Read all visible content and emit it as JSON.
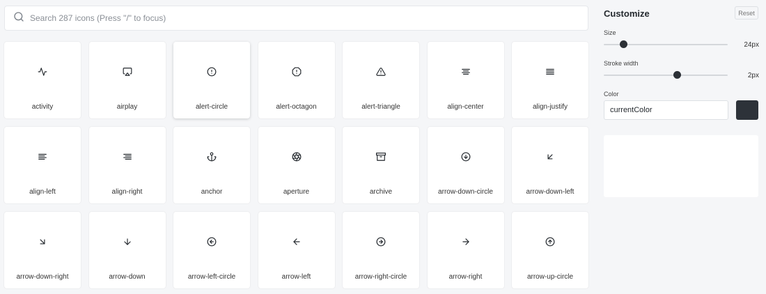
{
  "search": {
    "placeholder": "Search 287 icons (Press \"/\" to focus)"
  },
  "icons": [
    {
      "name": "activity",
      "icon": "activity-icon"
    },
    {
      "name": "airplay",
      "icon": "airplay-icon"
    },
    {
      "name": "alert-circle",
      "icon": "alert-circle-icon"
    },
    {
      "name": "alert-octagon",
      "icon": "alert-octagon-icon"
    },
    {
      "name": "alert-triangle",
      "icon": "alert-triangle-icon"
    },
    {
      "name": "align-center",
      "icon": "align-center-icon"
    },
    {
      "name": "align-justify",
      "icon": "align-justify-icon"
    },
    {
      "name": "align-left",
      "icon": "align-left-icon"
    },
    {
      "name": "align-right",
      "icon": "align-right-icon"
    },
    {
      "name": "anchor",
      "icon": "anchor-icon"
    },
    {
      "name": "aperture",
      "icon": "aperture-icon"
    },
    {
      "name": "archive",
      "icon": "archive-icon"
    },
    {
      "name": "arrow-down-circle",
      "icon": "arrow-down-circle-icon"
    },
    {
      "name": "arrow-down-left",
      "icon": "arrow-down-left-icon"
    },
    {
      "name": "arrow-down-right",
      "icon": "arrow-down-right-icon"
    },
    {
      "name": "arrow-down",
      "icon": "arrow-down-icon"
    },
    {
      "name": "arrow-left-circle",
      "icon": "arrow-left-circle-icon"
    },
    {
      "name": "arrow-left",
      "icon": "arrow-left-icon"
    },
    {
      "name": "arrow-right-circle",
      "icon": "arrow-right-circle-icon"
    },
    {
      "name": "arrow-right",
      "icon": "arrow-right-icon"
    },
    {
      "name": "arrow-up-circle",
      "icon": "arrow-up-circle-icon"
    }
  ],
  "customize": {
    "title": "Customize",
    "reset_label": "Reset",
    "size": {
      "label": "Size",
      "value": 24,
      "unit": "px",
      "display": "24px",
      "min": 12,
      "max": 100
    },
    "stroke": {
      "label": "Stroke width",
      "value": 2,
      "unit": "px",
      "display": "2px",
      "min": 0.5,
      "max": 3
    },
    "color": {
      "label": "Color",
      "value": "currentColor",
      "swatch": "#2d3239"
    }
  },
  "colors": {
    "icon_stroke": "#24292e",
    "thumb": "#2c3036"
  }
}
